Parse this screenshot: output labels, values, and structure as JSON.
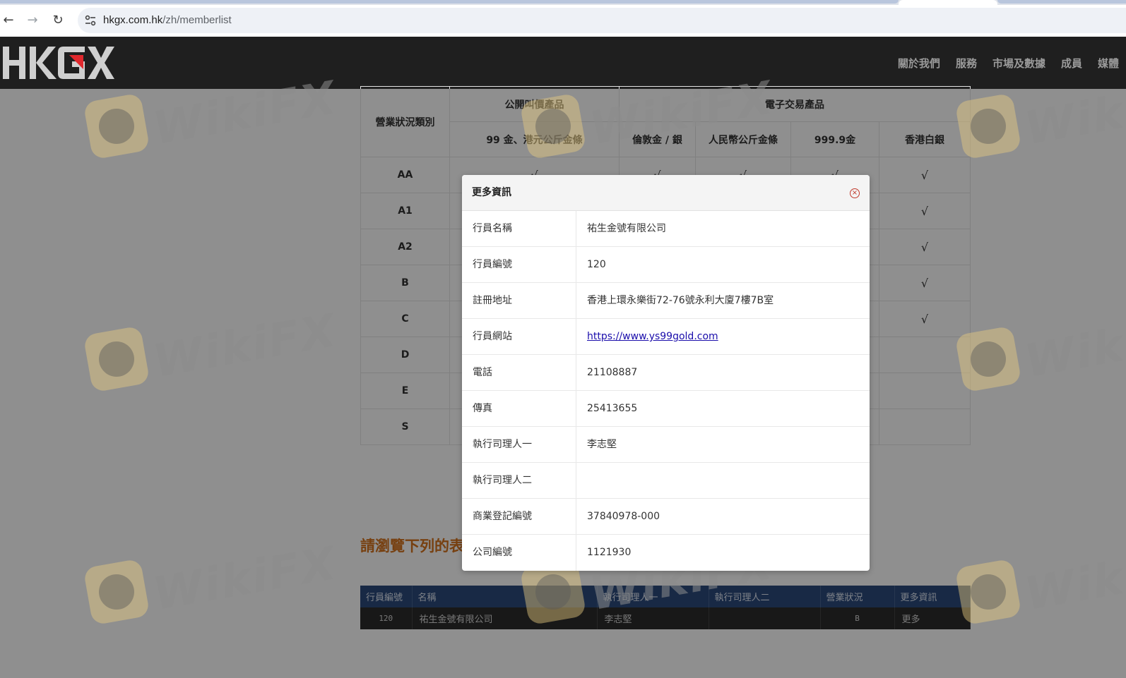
{
  "browser": {
    "url_host": "hkgx.com.hk",
    "url_path": "/zh/memberlist"
  },
  "site": {
    "logo_text": "HKGX",
    "nav": [
      "關於我們",
      "服務",
      "市場及數據",
      "成員",
      "媒體"
    ]
  },
  "category_table": {
    "header_col": "營業狀況類別",
    "group1": "公開叫價產品",
    "group2": "電子交易產品",
    "subheaders": [
      "99 金、港元公斤金條",
      "倫敦金 / 銀",
      "人民幣公斤金條",
      "999.9金",
      "香港白銀"
    ],
    "rows": [
      {
        "cat": "AA",
        "checks": [
          "√",
          "√",
          "√",
          "√",
          "√"
        ]
      },
      {
        "cat": "A1",
        "checks": [
          "",
          "",
          "",
          "",
          "√"
        ]
      },
      {
        "cat": "A2",
        "checks": [
          "",
          "",
          "",
          "",
          "√"
        ]
      },
      {
        "cat": "B",
        "checks": [
          "",
          "",
          "",
          "",
          "√"
        ]
      },
      {
        "cat": "C",
        "checks": [
          "",
          "",
          "",
          "",
          "√"
        ]
      },
      {
        "cat": "D",
        "checks": [
          "",
          "",
          "",
          "",
          ""
        ]
      },
      {
        "cat": "E",
        "checks": [
          "",
          "",
          "",
          "",
          ""
        ]
      },
      {
        "cat": "S",
        "checks": [
          "",
          "",
          "",
          "",
          ""
        ]
      }
    ]
  },
  "browse_title": "請瀏覽下列的表",
  "member_table": {
    "headers": [
      "行員編號",
      "名稱",
      "執行司理人一",
      "執行司理人二",
      "營業狀況",
      "更多資訊"
    ],
    "row": [
      "120",
      "祐生金號有限公司",
      "李志堅",
      "",
      "B",
      "更多"
    ]
  },
  "modal": {
    "title": "更多資訊",
    "rows": [
      {
        "label": "行員名稱",
        "value": "祐生金號有限公司"
      },
      {
        "label": "行員編號",
        "value": "120"
      },
      {
        "label": "註冊地址",
        "value": "香港上環永樂街72-76號永利大廈7樓7B室"
      },
      {
        "label": "行員網站",
        "value": "https://www.ys99gold.com"
      },
      {
        "label": "電話",
        "value": "21108887"
      },
      {
        "label": "傳真",
        "value": "25413655"
      },
      {
        "label": "執行司理人一",
        "value": "李志堅"
      },
      {
        "label": "執行司理人二",
        "value": ""
      },
      {
        "label": "商業登記編號",
        "value": "37840978-000"
      },
      {
        "label": "公司編號",
        "value": "1121930"
      }
    ]
  },
  "watermark": "WikiFX",
  "colors": {
    "header_bg": "#1f1f1f",
    "accent_orange": "#d4731e",
    "table_head_blue": "#2c4a7c",
    "logo_red": "#e0282d"
  }
}
